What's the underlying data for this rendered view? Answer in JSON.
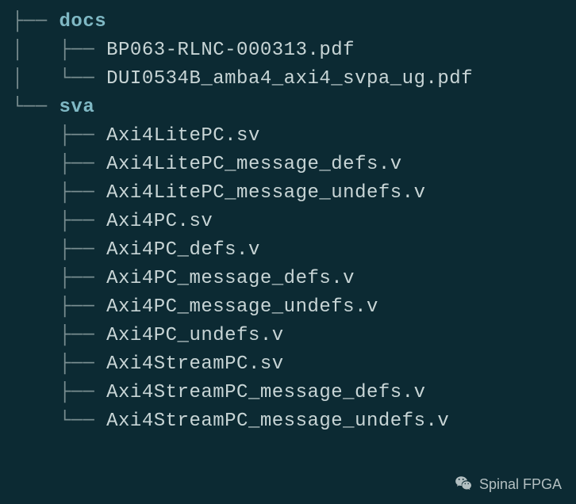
{
  "tree": {
    "dir1": "docs",
    "dir1_files": [
      "BP063-RLNC-000313.pdf",
      "DUI0534B_amba4_axi4_svpa_ug.pdf"
    ],
    "dir2": "sva",
    "dir2_files": [
      "Axi4LitePC.sv",
      "Axi4LitePC_message_defs.v",
      "Axi4LitePC_message_undefs.v",
      "Axi4PC.sv",
      "Axi4PC_defs.v",
      "Axi4PC_message_defs.v",
      "Axi4PC_message_undefs.v",
      "Axi4PC_undefs.v",
      "Axi4StreamPC.sv",
      "Axi4StreamPC_message_defs.v",
      "Axi4StreamPC_message_undefs.v"
    ]
  },
  "connectors": {
    "mid": "├──",
    "last": "└──",
    "pipe": "│",
    "space": " "
  },
  "watermark": {
    "text": "Spinal FPGA",
    "icon_name": "wechat-icon"
  }
}
